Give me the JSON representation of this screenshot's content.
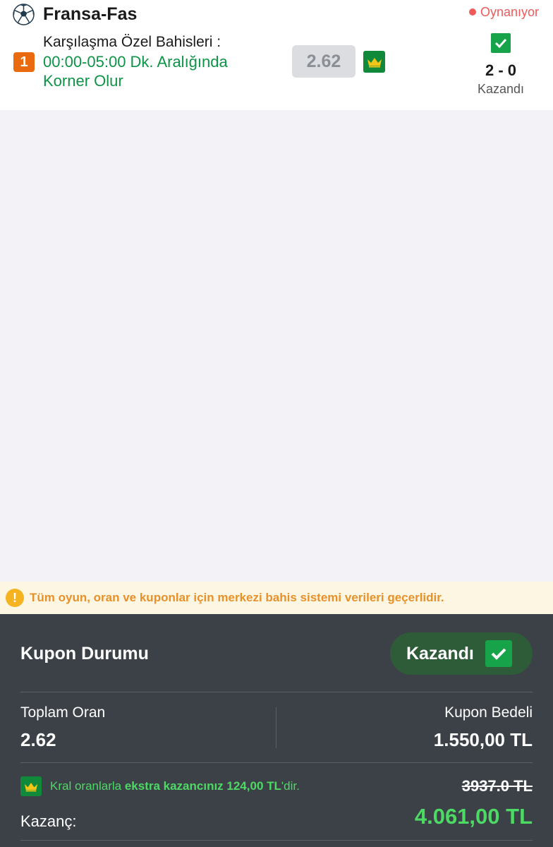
{
  "match": {
    "teams": "Fransa-Fas",
    "live_status": "Oynanıyor",
    "bet_number": "1",
    "market": "Karşılaşma Özel Bahisleri :",
    "selection": "00:00-05:00 Dk. Aralığında Korner Olur",
    "odd": "2.62",
    "score": "2 - 0",
    "result": "Kazandı",
    "icons": {
      "sport": "football-icon",
      "crown": "crown-icon",
      "check": "check-icon"
    }
  },
  "notice": {
    "icon": "warning-icon",
    "text": "Tüm oyun, oran ve kuponlar için merkezi bahis sistemi verileri geçerlidir."
  },
  "coupon": {
    "status_label": "Kupon Durumu",
    "status_value": "Kazandı",
    "total_odd_label": "Toplam Oran",
    "total_odd_value": "2.62",
    "stake_label": "Kupon Bedeli",
    "stake_value": "1.550,00 TL",
    "bonus_prefix": "Kral oranlarla ",
    "bonus_bold": "ekstra kazancınız 124,00 TL",
    "bonus_suffix": "'dir.",
    "old_winnings": "3937.0 TL",
    "winnings_label": "Kazanç:",
    "winnings_value": "4.061,00 TL"
  },
  "colors": {
    "live": "#ef5a5a",
    "selection": "#0d9447",
    "win": "#4cd964",
    "panel": "#3c4147",
    "notice_text": "#e8912a"
  }
}
